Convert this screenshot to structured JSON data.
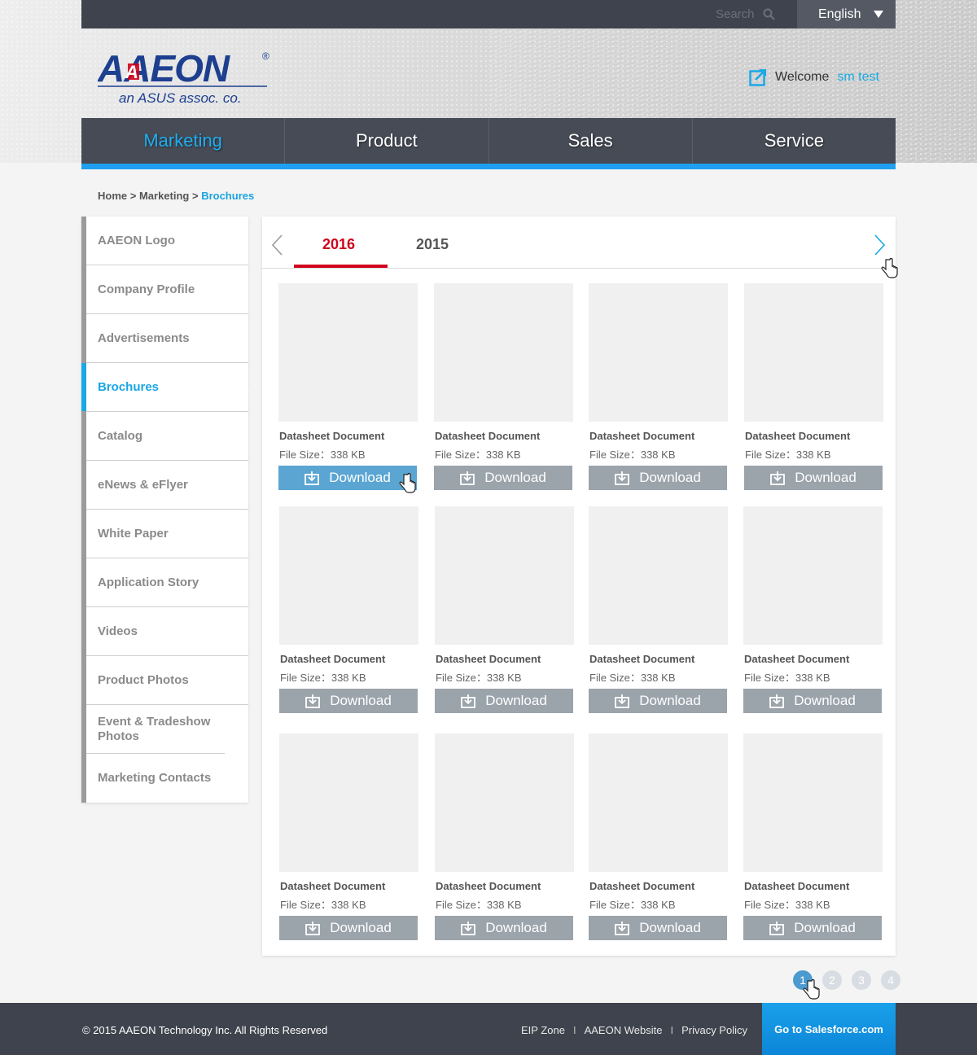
{
  "header": {
    "search_placeholder": "Search",
    "language": "English",
    "logo_brand": "AAEON",
    "logo_tagline": "an ASUS assoc. co.",
    "welcome_label": "Welcome",
    "user_name": "sm test"
  },
  "nav": [
    {
      "label": "Marketing",
      "active": true
    },
    {
      "label": "Product",
      "active": false
    },
    {
      "label": "Sales",
      "active": false
    },
    {
      "label": "Service",
      "active": false
    }
  ],
  "breadcrumb": {
    "home": "Home",
    "sep": " > ",
    "section": "Marketing",
    "current": "Brochures"
  },
  "sidebar": [
    "AAEON Logo",
    "Company Profile",
    "Advertisements",
    "Brochures",
    "Catalog",
    "eNews & eFlyer",
    "White Paper",
    "Application Story",
    "Videos",
    "Product Photos",
    "Event & Tradeshow Photos",
    "Marketing Contacts"
  ],
  "sidebar_active": "Brochures",
  "tabs": {
    "year_active": "2016",
    "year_other": "2015"
  },
  "documents": [
    {
      "title": "Datasheet Document",
      "size": "File Size：338 KB",
      "button": "Download"
    },
    {
      "title": "Datasheet Document",
      "size": "File Size：338 KB",
      "button": "Download"
    },
    {
      "title": "Datasheet Document",
      "size": "File Size：338 KB",
      "button": "Download"
    },
    {
      "title": "Datasheet Document",
      "size": "File Size：338 KB",
      "button": "Download"
    },
    {
      "title": "Datasheet Document",
      "size": "File Size：338 KB",
      "button": "Download"
    },
    {
      "title": "Datasheet Document",
      "size": "File Size：338 KB",
      "button": "Download"
    },
    {
      "title": "Datasheet Document",
      "size": "File Size：338 KB",
      "button": "Download"
    },
    {
      "title": "Datasheet Document",
      "size": "File Size：338 KB",
      "button": "Download"
    },
    {
      "title": "Datasheet Document",
      "size": "File Size：338 KB",
      "button": "Download"
    },
    {
      "title": "Datasheet Document",
      "size": "File Size：338 KB",
      "button": "Download"
    },
    {
      "title": "Datasheet Document",
      "size": "File Size：338 KB",
      "button": "Download"
    },
    {
      "title": "Datasheet Document",
      "size": "File Size：338 KB",
      "button": "Download"
    }
  ],
  "pagination": [
    "1",
    "2",
    "3",
    "4"
  ],
  "pagination_current": "1",
  "footer": {
    "copyright": "© 2015 AAEON Technology Inc. All Rights Reserved",
    "link_eip": "EIP Zone",
    "link_website": "AAEON Website",
    "link_privacy": "Privacy Policy",
    "link_sep": "I",
    "salesforce": "Go to Salesforce.com"
  },
  "colors": {
    "accent_blue": "#1aa8e6",
    "active_tab_red": "#d0021b",
    "nav_bg": "#474b55",
    "download_btn": "#9ba3ab",
    "download_btn_hover": "#5aa5d2"
  }
}
